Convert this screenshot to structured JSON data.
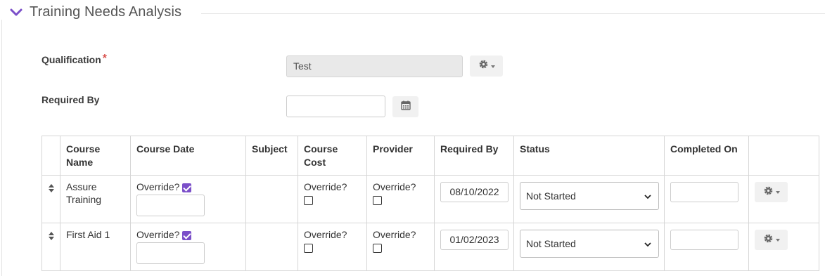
{
  "section": {
    "title": "Training Needs Analysis",
    "icon": "chevron-down-icon",
    "accent_color": "#7b4fc9"
  },
  "form": {
    "qualification": {
      "label": "Qualification",
      "required_marker": "*",
      "value": "Test"
    },
    "required_by": {
      "label": "Required By",
      "value": ""
    }
  },
  "table": {
    "headers": [
      "",
      "Course Name",
      "Course Date",
      "Subject",
      "Course Cost",
      "Provider",
      "Required By",
      "Status",
      "Completed On",
      ""
    ],
    "rows": [
      {
        "course_name": "Assure Training",
        "course_date_override_label": "Override?",
        "course_date_override_checked": true,
        "course_cost_override_label": "Override?",
        "provider_override_label": "Override?",
        "required_by": "08/10/2022",
        "status": "Not Started",
        "completed_on": ""
      },
      {
        "course_name": "First Aid 1",
        "course_date_override_label": "Override?",
        "course_date_override_checked": true,
        "course_cost_override_label": "Override?",
        "provider_override_label": "Override?",
        "required_by": "01/02/2023",
        "status": "Not Started",
        "completed_on": ""
      }
    ]
  }
}
